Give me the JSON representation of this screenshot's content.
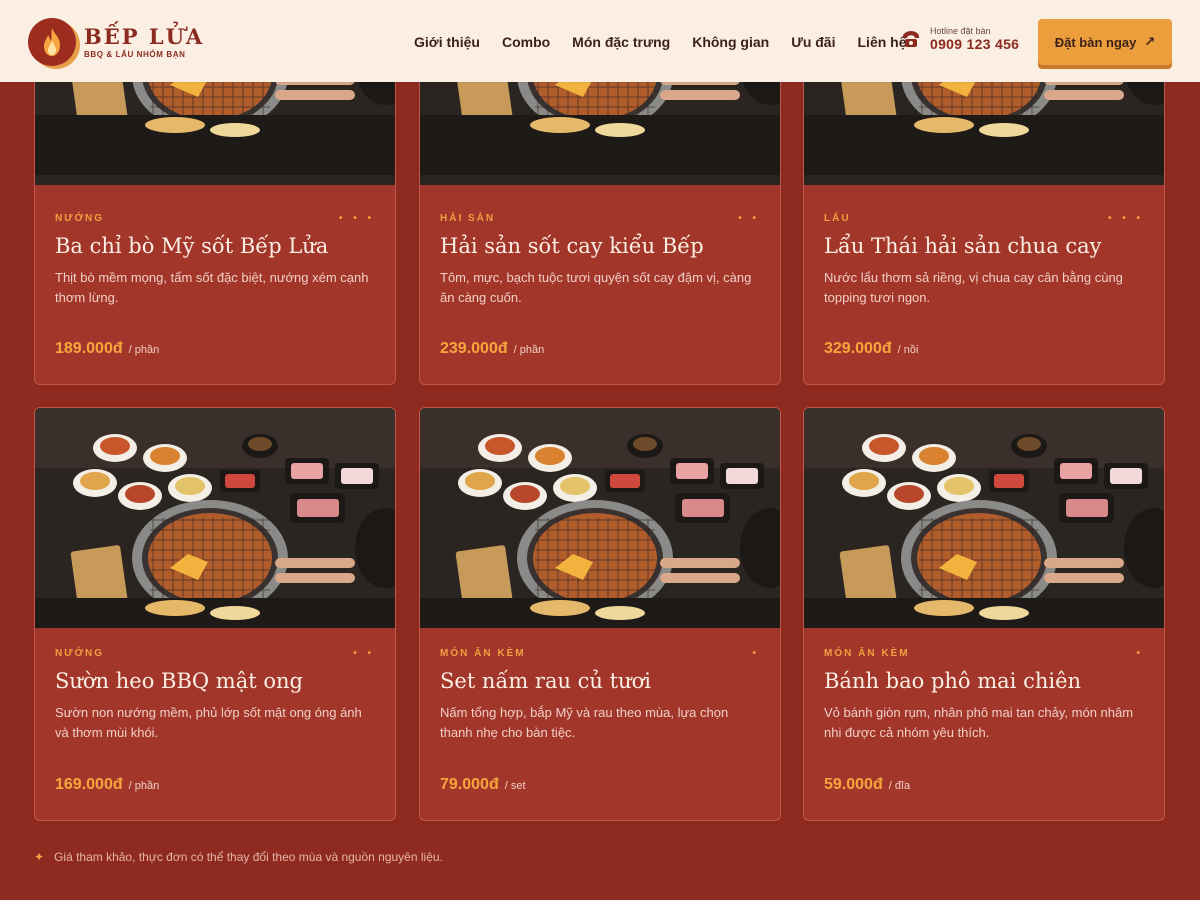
{
  "brand": {
    "name": "BẾP LỬA",
    "tagline": "BBQ & LẨU NHÓM BẠN",
    "logo_icon": "flame-icon"
  },
  "nav": {
    "items": [
      "Giới thiệu",
      "Combo",
      "Món đặc trưng",
      "Không gian",
      "Ưu đãi",
      "Liên hệ"
    ]
  },
  "hotline": {
    "label": "Hotline đặt bàn",
    "number": "0909 123 456",
    "icon": "phone-icon"
  },
  "cta": {
    "label": "Đặt bàn ngay",
    "icon": "arrow-up-right-icon"
  },
  "menu": {
    "items": [
      {
        "tag": "NƯỚNG",
        "dots": "• • •",
        "title": "Ba chỉ bò Mỹ sốt Bếp Lửa",
        "desc": "Thịt bò mềm mọng, tẩm sốt đặc biệt, nướng xém cạnh thơm lừng.",
        "price": "189.000đ",
        "unit": "/ phần"
      },
      {
        "tag": "HẢI SẢN",
        "dots": "• •",
        "title": "Hải sản sốt cay kiểu Bếp",
        "desc": "Tôm, mực, bạch tuộc tươi quyện sốt cay đậm vị, càng ăn càng cuốn.",
        "price": "239.000đ",
        "unit": "/ phần"
      },
      {
        "tag": "LẨU",
        "dots": "• • •",
        "title": "Lẩu Thái hải sản chua cay",
        "desc": "Nước lẩu thơm sả riềng, vị chua cay cân bằng cùng topping tươi ngon.",
        "price": "329.000đ",
        "unit": "/ nồi"
      },
      {
        "tag": "NƯỚNG",
        "dots": "• •",
        "title": "Sườn heo BBQ mật ong",
        "desc": "Sườn non nướng mềm, phủ lớp sốt mật ong óng ánh và thơm mùi khói.",
        "price": "169.000đ",
        "unit": "/ phần"
      },
      {
        "tag": "MÓN ĂN KÈM",
        "dots": "•",
        "title": "Set nấm rau củ tươi",
        "desc": "Nấm tổng hợp, bắp Mỹ và rau theo mùa, lựa chọn thanh nhẹ cho bàn tiệc.",
        "price": "79.000đ",
        "unit": "/ set"
      },
      {
        "tag": "MÓN ĂN KÈM",
        "dots": "•",
        "title": "Bánh bao phô mai chiên",
        "desc": "Vỏ bánh giòn rụm, nhân phô mai tan chảy, món nhâm nhi được cả nhóm yêu thích.",
        "price": "59.000đ",
        "unit": "/ đĩa"
      }
    ]
  },
  "note": {
    "icon": "sparkle-icon",
    "text": "Giá tham khảo, thực đơn có thể thay đổi theo mùa và nguồn nguyên liệu."
  },
  "colors": {
    "background": "#8f2a20",
    "card": "#a3362a",
    "header": "#fbefe4",
    "accent": "#ec9e3c",
    "brand": "#8b2a1f"
  }
}
